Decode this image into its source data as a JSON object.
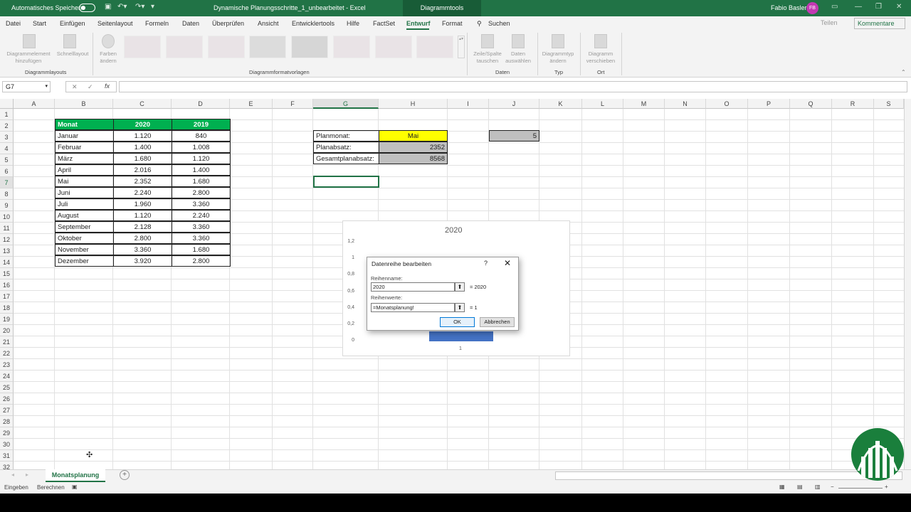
{
  "titlebar": {
    "autosave_label": "Automatisches Speichern",
    "doc_title": "Dynamische Planungsschritte_1_unbearbeitet  -  Excel",
    "contextual_tab": "Diagrammtools",
    "user_name": "Fabio Basler",
    "user_initials": "FB"
  },
  "menu": {
    "tabs": [
      "Datei",
      "Start",
      "Einfügen",
      "Seitenlayout",
      "Formeln",
      "Daten",
      "Überprüfen",
      "Ansicht",
      "Entwicklertools",
      "Hilfe",
      "FactSet",
      "Entwurf",
      "Format"
    ],
    "active_tab": "Entwurf",
    "search": "Suchen",
    "share": "Teilen",
    "comments": "Kommentare"
  },
  "ribbon": {
    "btn_add_element": "Diagrammelement hinzufügen",
    "btn_quick_layout": "Schnelllayout",
    "btn_colors": "Farben ändern",
    "btn_switch": "Zeile/Spalte tauschen",
    "btn_select_data": "Daten auswählen",
    "btn_change_type": "Diagrammtyp ändern",
    "btn_move_chart": "Diagramm verschieben",
    "group_layouts": "Diagrammlayouts",
    "group_styles": "Diagrammformatvorlagen",
    "group_data": "Daten",
    "group_type": "Typ",
    "group_location": "Ort"
  },
  "formula_bar": {
    "name_box": "G7",
    "fx": "fx",
    "cancel": "✕",
    "confirm": "✓",
    "content": ""
  },
  "grid": {
    "columns": [
      "A",
      "B",
      "C",
      "D",
      "E",
      "F",
      "G",
      "H",
      "I",
      "J",
      "K",
      "L",
      "M",
      "N",
      "O",
      "P",
      "Q",
      "R",
      "S"
    ],
    "rows": [
      "1",
      "2",
      "3",
      "4",
      "5",
      "6",
      "7",
      "8",
      "9",
      "10",
      "11",
      "12",
      "13",
      "14",
      "15",
      "16",
      "17",
      "18",
      "19",
      "20",
      "21",
      "22",
      "23",
      "24",
      "25",
      "26",
      "27",
      "28",
      "29",
      "30",
      "31",
      "32"
    ]
  },
  "table": {
    "headers": [
      "Monat",
      "2020",
      "2019"
    ],
    "rows": [
      [
        "Januar",
        "1.120",
        "840"
      ],
      [
        "Februar",
        "1.400",
        "1.008"
      ],
      [
        "März",
        "1.680",
        "1.120"
      ],
      [
        "April",
        "2.016",
        "1.400"
      ],
      [
        "Mai",
        "2.352",
        "1.680"
      ],
      [
        "Juni",
        "2.240",
        "2.800"
      ],
      [
        "Juli",
        "1.960",
        "3.360"
      ],
      [
        "August",
        "1.120",
        "2.240"
      ],
      [
        "September",
        "2.128",
        "3.360"
      ],
      [
        "Oktober",
        "2.800",
        "3.360"
      ],
      [
        "November",
        "3.360",
        "1.680"
      ],
      [
        "Dezember",
        "3.920",
        "2.800"
      ]
    ]
  },
  "plan": {
    "month_label": "Planmonat:",
    "month_value": "Mai",
    "sales_label": "Planabsatz:",
    "sales_value": "2352",
    "total_label": "Gesamtplanabsatz:",
    "total_value": "8568",
    "index_value": "5"
  },
  "chart_data": {
    "type": "bar",
    "title": "2020",
    "categories": [
      "1"
    ],
    "series": [
      {
        "name": "2020",
        "values": [
          1
        ]
      }
    ],
    "y_ticks": [
      "0",
      "0,2",
      "0,4",
      "0,6",
      "0,8",
      "1",
      "1,2"
    ],
    "ylim": [
      0,
      1.2
    ],
    "xlabel": "",
    "ylabel": "",
    "bar_color": "#4472c4"
  },
  "dialog": {
    "title": "Datenreihe bearbeiten",
    "help": "?",
    "close": "✕",
    "name_label": "Reihenname:",
    "name_value": "2020",
    "name_result": "= 2020",
    "values_label": "Reihenwerte:",
    "values_value": "=Monatsplanung!",
    "values_result": "= 1",
    "ok": "OK",
    "cancel": "Abbrechen"
  },
  "sheet": {
    "active_tab": "Monatsplanung",
    "add": "+"
  },
  "status": {
    "mode": "Eingeben",
    "calc": "Berechnen",
    "zoom_minus": "−",
    "zoom_plus": "+"
  },
  "colors": {
    "excel_green": "#217346",
    "header_green": "#00b050",
    "highlight_yellow": "#ffff00",
    "result_gray": "#bfbfbf",
    "bar_blue": "#4472c4"
  }
}
